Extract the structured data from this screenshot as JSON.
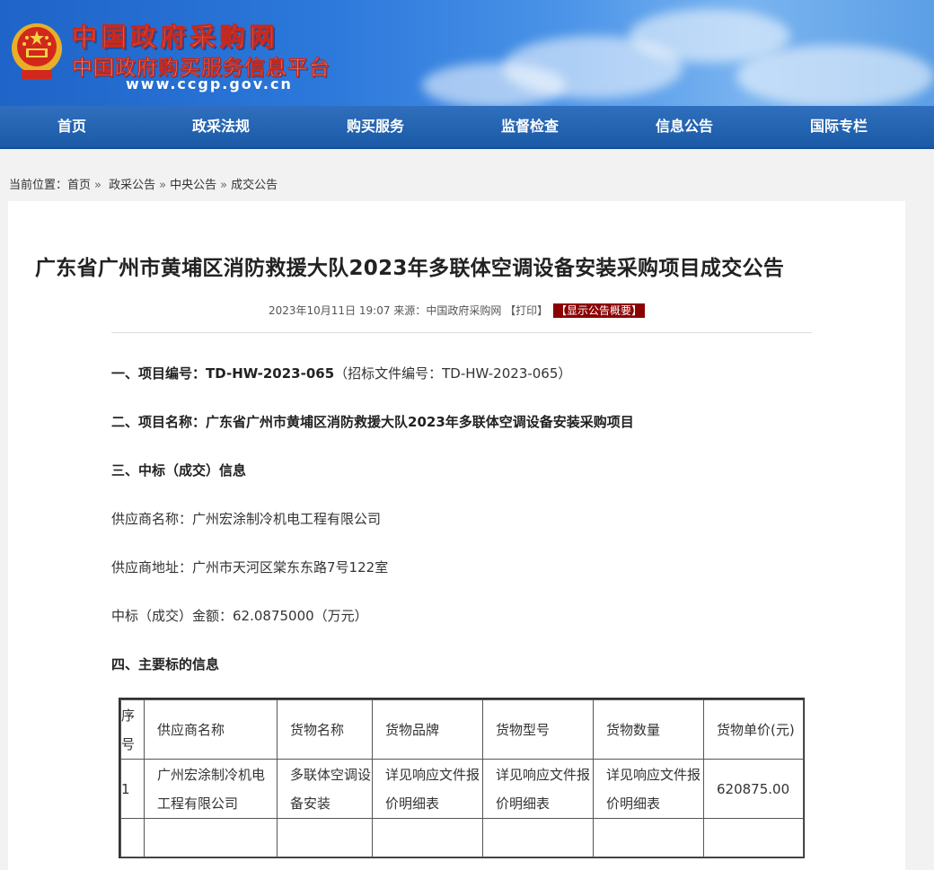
{
  "header": {
    "title": "中国政府采购网",
    "subtitle": "中国政府购买服务信息平台",
    "url": "www.ccgp.gov.cn"
  },
  "nav": {
    "items": [
      {
        "label": "首页"
      },
      {
        "label": "政采法规"
      },
      {
        "label": "购买服务"
      },
      {
        "label": "监督检查"
      },
      {
        "label": "信息公告"
      },
      {
        "label": "国际专栏"
      }
    ]
  },
  "breadcrumb": {
    "prefix": "当前位置：",
    "items": [
      "首页",
      "政采公告",
      "中央公告",
      "成交公告"
    ],
    "separator": "»"
  },
  "article": {
    "title": "广东省广州市黄埔区消防救援大队2023年多联体空调设备安装采购项目成交公告",
    "meta": {
      "datetime": "2023年10月11日 19:07",
      "source_label": "来源：",
      "source": "中国政府采购网",
      "print": "【打印】",
      "summary_button": "【显示公告概要】"
    },
    "sections": {
      "project_no_label": "一、项目编号：",
      "project_no": "TD-HW-2023-065",
      "project_no_extra": "（招标文件编号：TD-HW-2023-065）",
      "project_name_label": "二、项目名称：",
      "project_name": "广东省广州市黄埔区消防救援大队2023年多联体空调设备安装采购项目",
      "winner_heading": "三、中标（成交）信息",
      "supplier_name_label": "供应商名称：",
      "supplier_name": "广州宏涂制冷机电工程有限公司",
      "supplier_addr_label": "供应商地址：",
      "supplier_addr": "广州市天河区棠东东路7号122室",
      "amount_label": "中标（成交）金额：",
      "amount": "62.0875000（万元）",
      "main_info_heading": "四、主要标的信息"
    },
    "table": {
      "headers": [
        "序号",
        "供应商名称",
        "货物名称",
        "货物品牌",
        "货物型号",
        "货物数量",
        "货物单价(元)"
      ],
      "rows": [
        [
          "1",
          "广州宏涂制冷机电工程有限公司",
          "多联体空调设备安装",
          "详见响应文件报价明细表",
          "详见响应文件报价明细表",
          "详见响应文件报价明细表",
          "620875.00"
        ]
      ]
    }
  },
  "colors": {
    "nav_bg": "#1b5aa6",
    "summary_button_bg": "#8b0000",
    "page_bg": "#f2f2f2"
  }
}
